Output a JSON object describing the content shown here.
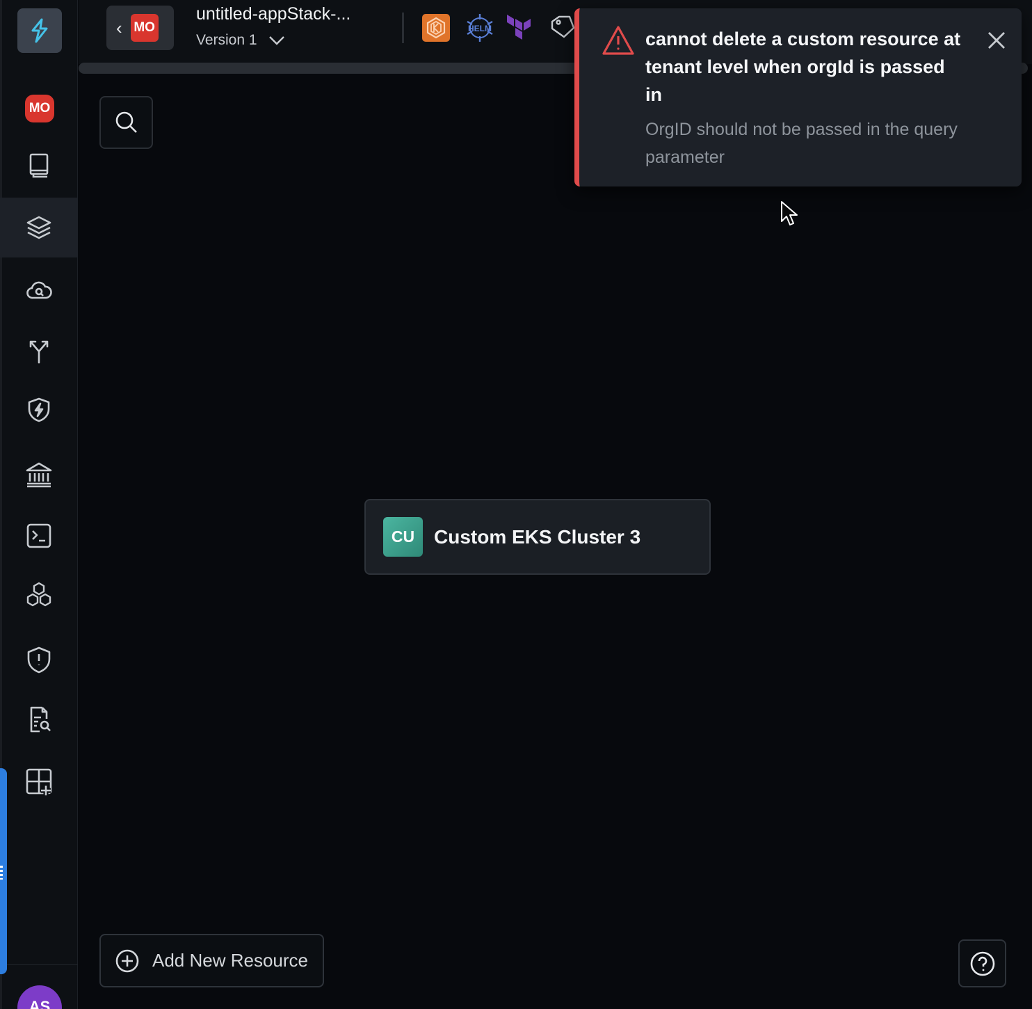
{
  "sidebar": {
    "logo_icon": "app-logo-icon",
    "org_badge": "MO",
    "items": [
      {
        "name": "catalog",
        "icon": "book-icon"
      },
      {
        "name": "stacks",
        "icon": "layers-icon",
        "active": true
      },
      {
        "name": "cloud",
        "icon": "cloud-search-icon"
      },
      {
        "name": "pipelines",
        "icon": "branch-icon"
      },
      {
        "name": "security",
        "icon": "shield-bolt-icon"
      },
      {
        "name": "governance",
        "icon": "bank-icon"
      },
      {
        "name": "terminal",
        "icon": "terminal-icon"
      },
      {
        "name": "modules",
        "icon": "cubes-icon"
      },
      {
        "name": "policies",
        "icon": "shield-alert-icon"
      },
      {
        "name": "audit",
        "icon": "doc-search-icon"
      },
      {
        "name": "add-widget",
        "icon": "grid-plus-icon"
      }
    ],
    "avatar_initials": "AS"
  },
  "topbar": {
    "back_org_badge": "MO",
    "stack_title": "untitled-appStack-...",
    "version_label": "Version 1",
    "tool_icons": [
      "kubernetes-icon",
      "helm-icon",
      "terraform-icon",
      "tag-icon"
    ],
    "helm_text": "HELM"
  },
  "canvas": {
    "resource_node": {
      "badge": "CU",
      "name": "Custom EKS Cluster 3",
      "badge_color": "#3fa08c"
    },
    "add_resource_label": "Add New Resource"
  },
  "toast": {
    "title": "cannot delete a custom resource at tenant level when orgId is passed in",
    "message": "OrgID should not be passed in the query parameter",
    "accent": "#e04b4b"
  },
  "colors": {
    "background": "#07090d",
    "panel": "#0d1014",
    "badge_red": "#d9362e",
    "avatar": "#7d3cc8",
    "drawer_blue": "#2d7ee0"
  }
}
